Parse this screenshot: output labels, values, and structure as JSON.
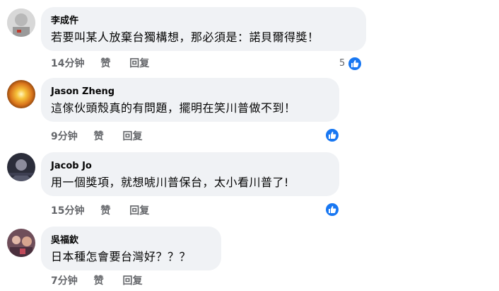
{
  "comments": [
    {
      "author": "李成仵",
      "text": "若要叫某人放棄台獨構想，那必須是：諾貝爾得獎！",
      "time": "14分钟",
      "like_label": "赞",
      "reply_label": "回复",
      "like_count": "5"
    },
    {
      "author": "Jason Zheng",
      "text": "這傢伙頭殼真的有問題，擺明在笑川普做不到！",
      "time": "9分钟",
      "like_label": "赞",
      "reply_label": "回复",
      "like_count": ""
    },
    {
      "author": "Jacob Jo",
      "text": "用一個獎項，就想唬川普保台，太小看川普了!",
      "time": "15分钟",
      "like_label": "赞",
      "reply_label": "回复",
      "like_count": ""
    },
    {
      "author": "吳福欽",
      "text": "日本種怎會要台灣好？？？",
      "time": "7分钟",
      "like_label": "赞",
      "reply_label": "回复",
      "like_count": ""
    }
  ],
  "colors": {
    "bubble_bg": "#f0f2f5",
    "meta_text": "#65676b",
    "like_blue": "#1877f2"
  },
  "icons": {
    "like": "thumbs-up-icon",
    "avatar": "user-avatar"
  }
}
